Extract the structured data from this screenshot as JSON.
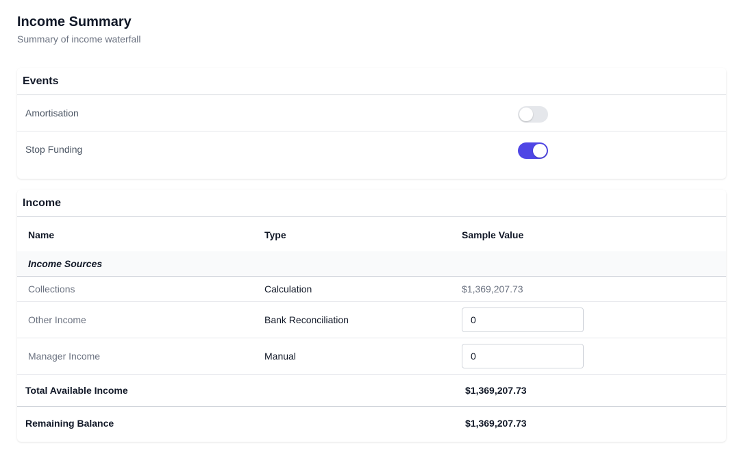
{
  "page": {
    "title": "Income Summary",
    "subtitle": "Summary of income waterfall"
  },
  "events": {
    "title": "Events",
    "items": [
      {
        "label": "Amortisation",
        "enabled": false
      },
      {
        "label": "Stop Funding",
        "enabled": true
      }
    ],
    "toggle_on_color": "#4f46e5",
    "toggle_off_color": "#e5e7eb"
  },
  "income": {
    "title": "Income",
    "columns": [
      "Name",
      "Type",
      "Sample Value"
    ],
    "group_label": "Income Sources",
    "rows": [
      {
        "name": "Collections",
        "type": "Calculation",
        "value": "$1,369,207.73"
      },
      {
        "name": "Other Income",
        "type": "Bank Reconciliation",
        "input_value": "0"
      },
      {
        "name": "Manager Income",
        "type": "Manual",
        "input_value": "0"
      }
    ],
    "totals": [
      {
        "label": "Total Available Income",
        "value": "$1,369,207.73"
      },
      {
        "label": "Remaining Balance",
        "value": "$1,369,207.73"
      }
    ]
  }
}
